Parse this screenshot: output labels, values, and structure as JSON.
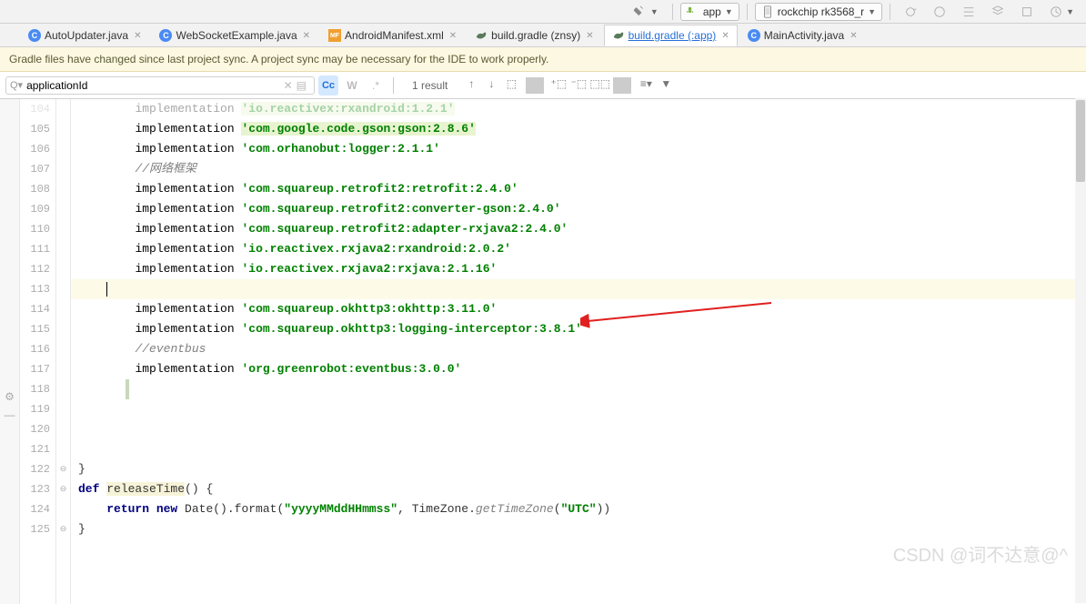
{
  "toolbar": {
    "hammer_icon": "hammer-icon",
    "app_label": "app",
    "device_label": "rockchip rk3568_r"
  },
  "tabs": [
    {
      "icon": "c",
      "label": "AutoUpdater.java",
      "active": false
    },
    {
      "icon": "c",
      "label": "WebSocketExample.java",
      "active": false
    },
    {
      "icon": "mf",
      "label": "AndroidManifest.xml",
      "active": false
    },
    {
      "icon": "gradle",
      "label": "build.gradle (znsy)",
      "active": false
    },
    {
      "icon": "gradle",
      "label": "build.gradle (:app)",
      "active": true
    },
    {
      "icon": "c",
      "label": "MainActivity.java",
      "active": false
    }
  ],
  "notice": "Gradle files have changed since last project sync. A project sync may be necessary for the IDE to work properly.",
  "find": {
    "value": "applicationId",
    "result": "1 result"
  },
  "code": {
    "lines": [
      {
        "n": 104,
        "parts": [
          {
            "t": "    ",
            "c": ""
          },
          {
            "t": "implementation ",
            "c": "impl"
          },
          {
            "t": "'io.reactivex:rxandroid:1.2.1'",
            "c": "str str-hl"
          }
        ]
      },
      {
        "n": 105,
        "parts": [
          {
            "t": "    ",
            "c": ""
          },
          {
            "t": "implementation ",
            "c": "impl"
          },
          {
            "t": "'com.google.code.gson:gson:2.8.6'",
            "c": "str str-hl"
          }
        ]
      },
      {
        "n": 106,
        "parts": [
          {
            "t": "    ",
            "c": ""
          },
          {
            "t": "implementation ",
            "c": "impl"
          },
          {
            "t": "'com.orhanobut:logger:2.1.1'",
            "c": "str"
          }
        ]
      },
      {
        "n": 107,
        "parts": [
          {
            "t": "    ",
            "c": ""
          },
          {
            "t": "//网络框架",
            "c": "cmt"
          }
        ]
      },
      {
        "n": 108,
        "parts": [
          {
            "t": "    ",
            "c": ""
          },
          {
            "t": "implementation ",
            "c": "impl"
          },
          {
            "t": "'com.squareup.retrofit2:retrofit:2.4.0'",
            "c": "str"
          }
        ]
      },
      {
        "n": 109,
        "parts": [
          {
            "t": "    ",
            "c": ""
          },
          {
            "t": "implementation ",
            "c": "impl"
          },
          {
            "t": "'com.squareup.retrofit2:converter-gson:2.4.0'",
            "c": "str"
          }
        ]
      },
      {
        "n": 110,
        "parts": [
          {
            "t": "    ",
            "c": ""
          },
          {
            "t": "implementation ",
            "c": "impl"
          },
          {
            "t": "'com.squareup.retrofit2:adapter-rxjava2:2.4.0'",
            "c": "str"
          }
        ]
      },
      {
        "n": 111,
        "parts": [
          {
            "t": "    ",
            "c": ""
          },
          {
            "t": "implementation ",
            "c": "impl"
          },
          {
            "t": "'io.reactivex.rxjava2:rxandroid:2.0.2'",
            "c": "str"
          }
        ]
      },
      {
        "n": 112,
        "parts": [
          {
            "t": "    ",
            "c": ""
          },
          {
            "t": "implementation ",
            "c": "impl"
          },
          {
            "t": "'io.reactivex.rxjava2:rxjava:2.1.16'",
            "c": "str"
          }
        ]
      },
      {
        "n": 113,
        "hl": true,
        "parts": [
          {
            "t": "",
            "c": ""
          }
        ]
      },
      {
        "n": 114,
        "parts": [
          {
            "t": "    ",
            "c": ""
          },
          {
            "t": "implementation ",
            "c": "impl"
          },
          {
            "t": "'com.squareup.okhttp3:okhttp:3.11.0'",
            "c": "str"
          }
        ]
      },
      {
        "n": 115,
        "parts": [
          {
            "t": "    ",
            "c": ""
          },
          {
            "t": "implementation ",
            "c": "impl"
          },
          {
            "t": "'com.squareup.okhttp3:logging-interceptor:3.8.1'",
            "c": "str"
          }
        ]
      },
      {
        "n": 116,
        "parts": [
          {
            "t": "    ",
            "c": ""
          },
          {
            "t": "//eventbus",
            "c": "cmt"
          }
        ]
      },
      {
        "n": 117,
        "parts": [
          {
            "t": "    ",
            "c": ""
          },
          {
            "t": "implementation ",
            "c": "impl"
          },
          {
            "t": "'org.greenrobot:eventbus:3.0.0'",
            "c": "str"
          }
        ]
      },
      {
        "n": 118,
        "parts": [
          {
            "t": "",
            "c": ""
          }
        ]
      },
      {
        "n": 119,
        "parts": [
          {
            "t": "",
            "c": ""
          }
        ]
      },
      {
        "n": 120,
        "parts": [
          {
            "t": "",
            "c": ""
          }
        ]
      },
      {
        "n": 121,
        "parts": [
          {
            "t": "",
            "c": ""
          }
        ]
      },
      {
        "n": 122,
        "parts": [
          {
            "t": "}",
            "c": ""
          }
        ],
        "fold": "⊖"
      },
      {
        "n": 123,
        "parts": [
          {
            "t": "def ",
            "c": "kw"
          },
          {
            "t": "releaseTime",
            "c": "fn-hl"
          },
          {
            "t": "() {",
            "c": ""
          }
        ],
        "fold": "⊖"
      },
      {
        "n": 124,
        "parts": [
          {
            "t": "    ",
            "c": ""
          },
          {
            "t": "return new ",
            "c": "kw"
          },
          {
            "t": "Date().format(",
            "c": ""
          },
          {
            "t": "\"yyyyMMddHHmmss\"",
            "c": "str"
          },
          {
            "t": ", TimeZone.",
            "c": ""
          },
          {
            "t": "getTimeZone",
            "c": "cmt",
            "i": true
          },
          {
            "t": "(",
            "c": ""
          },
          {
            "t": "\"UTC\"",
            "c": "str"
          },
          {
            "t": "))",
            "c": ""
          }
        ]
      },
      {
        "n": 125,
        "parts": [
          {
            "t": "}",
            "c": ""
          }
        ],
        "fold": "⊖"
      }
    ]
  },
  "watermark": "CSDN @词不达意@^"
}
